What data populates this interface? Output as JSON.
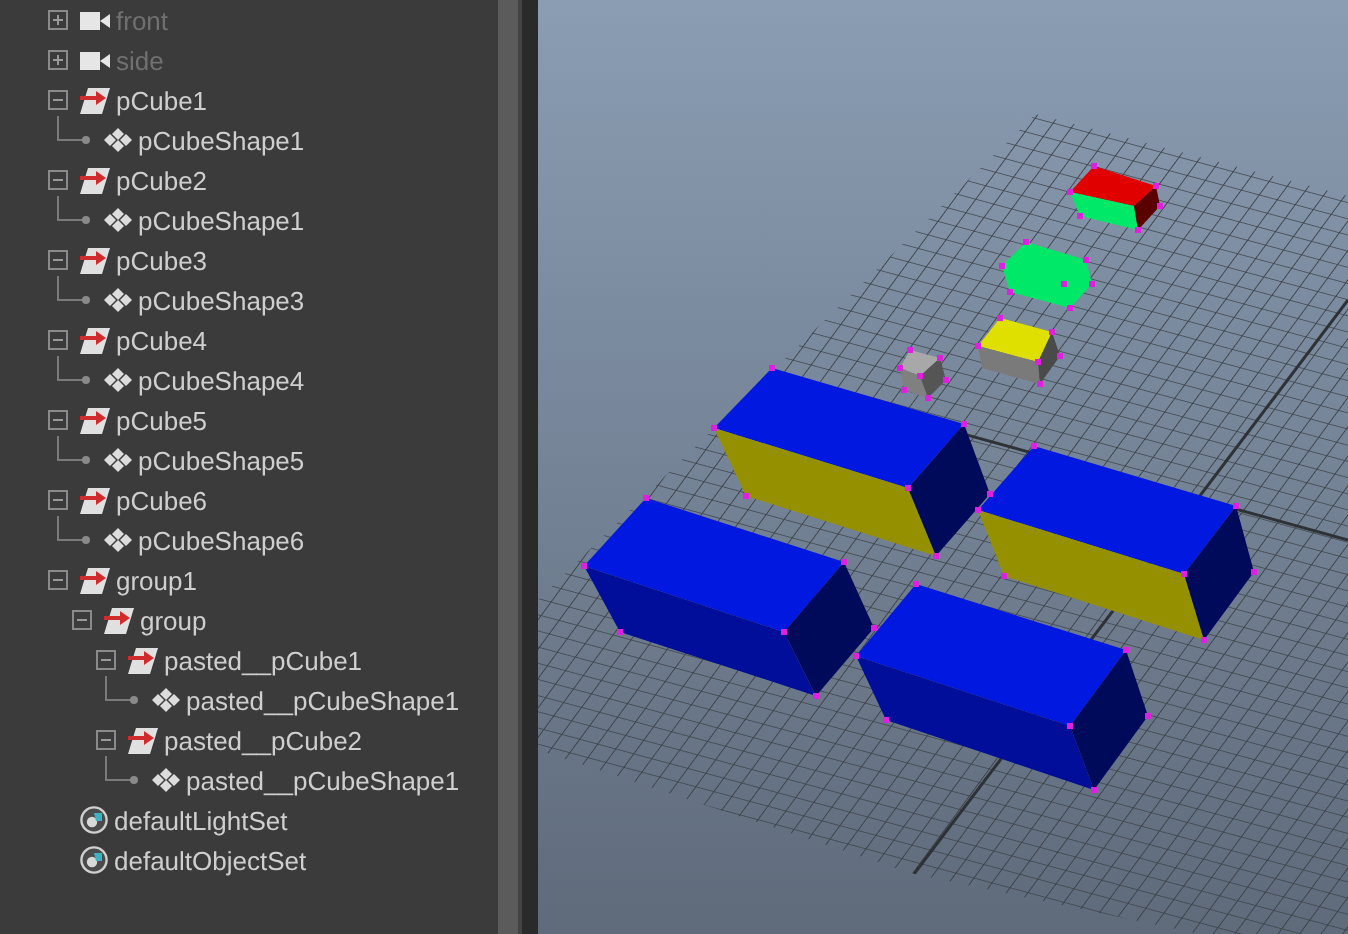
{
  "outliner": {
    "items": [
      {
        "kind": "camera",
        "label": "front",
        "expanded": false,
        "hidden": true
      },
      {
        "kind": "camera",
        "label": "side",
        "expanded": false,
        "hidden": true
      },
      {
        "kind": "transform",
        "label": "pCube1",
        "expanded": true,
        "hidden": false,
        "children": [
          {
            "kind": "shape",
            "label": "pCubeShape1"
          }
        ]
      },
      {
        "kind": "transform",
        "label": "pCube2",
        "expanded": true,
        "hidden": false,
        "children": [
          {
            "kind": "shape",
            "label": "pCubeShape1"
          }
        ]
      },
      {
        "kind": "transform",
        "label": "pCube3",
        "expanded": true,
        "hidden": false,
        "children": [
          {
            "kind": "shape",
            "label": "pCubeShape3"
          }
        ]
      },
      {
        "kind": "transform",
        "label": "pCube4",
        "expanded": true,
        "hidden": false,
        "children": [
          {
            "kind": "shape",
            "label": "pCubeShape4"
          }
        ]
      },
      {
        "kind": "transform",
        "label": "pCube5",
        "expanded": true,
        "hidden": false,
        "children": [
          {
            "kind": "shape",
            "label": "pCubeShape5"
          }
        ]
      },
      {
        "kind": "transform",
        "label": "pCube6",
        "expanded": true,
        "hidden": false,
        "children": [
          {
            "kind": "shape",
            "label": "pCubeShape6"
          }
        ]
      },
      {
        "kind": "transform",
        "label": "group1",
        "expanded": true,
        "hidden": false,
        "children": [
          {
            "kind": "transform",
            "label": "group",
            "expanded": true,
            "hidden": false,
            "children": [
              {
                "kind": "transform",
                "label": "pasted__pCube1",
                "expanded": true,
                "hidden": false,
                "children": [
                  {
                    "kind": "shape",
                    "label": "pasted__pCubeShape1"
                  }
                ]
              },
              {
                "kind": "transform",
                "label": "pasted__pCube2",
                "expanded": true,
                "hidden": false,
                "children": [
                  {
                    "kind": "shape",
                    "label": "pasted__pCubeShape1"
                  }
                ]
              }
            ]
          }
        ]
      },
      {
        "kind": "set",
        "label": "defaultLightSet"
      },
      {
        "kind": "set",
        "label": "defaultObjectSet"
      }
    ]
  }
}
